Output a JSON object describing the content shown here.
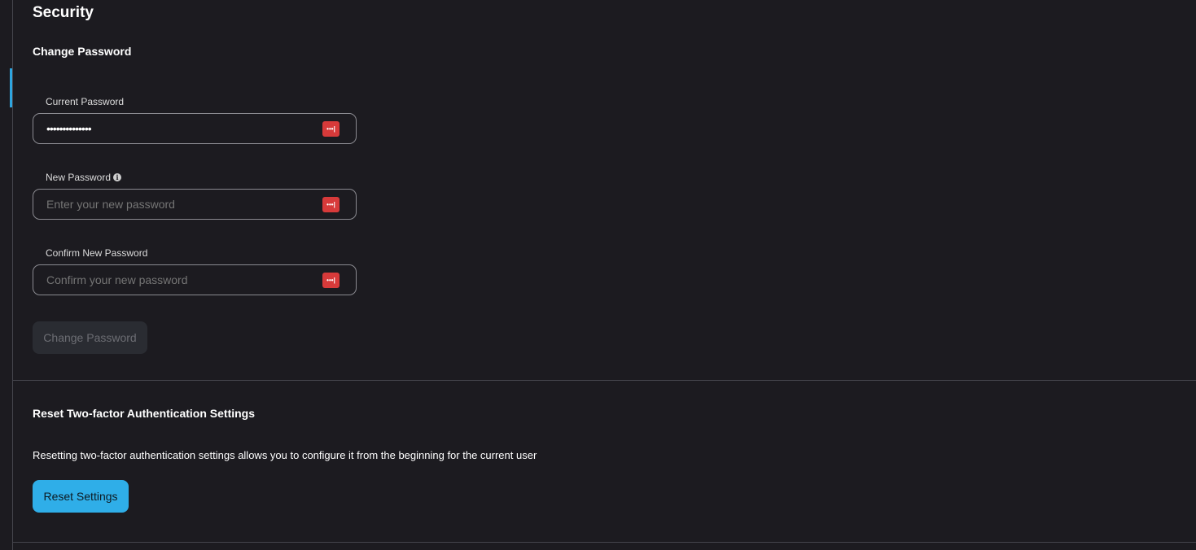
{
  "page": {
    "title": "Security"
  },
  "change_password": {
    "section_title": "Change Password",
    "current_password": {
      "label": "Current Password",
      "value": "••••••••••••••"
    },
    "new_password": {
      "label": "New Password",
      "placeholder": "Enter your new password",
      "info_icon": "info-circle-icon"
    },
    "confirm_password": {
      "label": "Confirm New Password",
      "placeholder": "Confirm your new password"
    },
    "password_manager_icon": "password-manager-icon",
    "password_manager_glyph": "•••|",
    "submit_label": "Change Password"
  },
  "two_factor": {
    "section_title": "Reset Two-factor Authentication Settings",
    "description": "Resetting two-factor authentication settings allows you to configure it from the beginning for the current user",
    "reset_label": "Reset Settings"
  },
  "colors": {
    "background": "#1c1b20",
    "accent": "#2faee8",
    "password_manager": "#d73a3a",
    "disabled_button": "#2a2c32"
  }
}
